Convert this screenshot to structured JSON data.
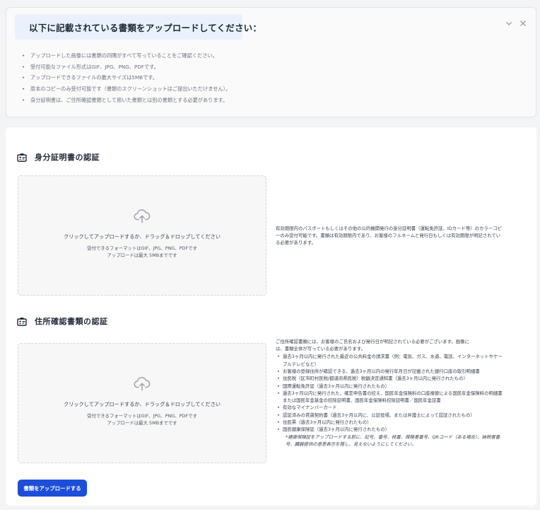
{
  "notice": {
    "title": "以下に記載されている書類をアップロードしてください：",
    "icons": {
      "info": "info-icon",
      "collapse": "chevron-down-icon",
      "close": "close-icon"
    },
    "items": [
      "アップロードした画像には書類の四隅がすべて写っていることをご確認ください。",
      "受付可能なファイル形式はGIF、JPG、PNG、PDFです。",
      "アップロードできるファイルの最大サイズは5MBです。",
      "原本のコピーのみ受付可能です（書類のスクリーンショットはご提出いただけません）。",
      "身分証明書は、ご住所確認書類として用いた書類とは別の書類とする必要があります。"
    ]
  },
  "identity": {
    "title": "身分証明書の認証",
    "icon": "id-card-icon",
    "dropzone": {
      "icon": "cloud-upload-icon",
      "main": "クリックしてアップロードするか、ドラッグ＆ドロップしてください",
      "formats": "受付できるフォーマットはGIF、JPG、PNG、PDFです",
      "max": "アップロードは最大 5MBまでです"
    },
    "lines": [
      "有効期限内のパスポートもしくはその他の公的機関発行の身分証明書（運転免許証、IDカード等）のカラーコピ",
      "ーのみ受付可能です。書類は有効期限内であり、お客様のフルネームと発行日もしくは有効期限が明記されてい",
      "る必要があります。"
    ]
  },
  "address": {
    "title": "住所確認書類の認証",
    "icon": "id-card-icon",
    "dropzone": {
      "icon": "cloud-upload-icon",
      "main": "クリックしてアップロードするか、ドラッグ＆ドロップしてください",
      "formats": "受付できるフォーマットはGIF、JPG、PNG、PDFです",
      "max": "アップロードは最大 5MBまでです"
    },
    "intro": [
      "ご住所確認書類には、お客様のご氏名および発行日が明記されている必要がございます。画像に",
      "は、書類全体が写っている必要があります。"
    ],
    "items": [
      "過去3ヶ月以内に発行された最近の公共料金の請求書（例：電気、ガス、水道、電話、インターネットやケー",
      "ブルテレビなど）",
      "お客様の登録住所が確認できる、過去3ヶ月以内の発行年月日が記載された銀行口座の取引明細書",
      "住民税（区市町村民税/都道府県民税）税額決定通知書（過去3ヶ月以内に発行されたもの）",
      "国際運転免許証（過去3ヶ月以内に発行されたもの）",
      "過去3ヶ月以内に発行された、確定申告書の控え、国民年金保険料の口座振替による国民年金保険料の明細書",
      "または国民年金基金の控除証明書、国民年金保険料控除証明書／国民年金証書",
      "有効なマイナンバーカード",
      "認証済みの賃貸契約書（過去3ヶ月以内に、公証役場、または弁護士によって認証されたもの）",
      "住民票（過去3ヶ月以内に発行されたもの）",
      "国民健康保険証（過去3ヶ月以内に発行されたもの）"
    ],
    "note": [
      "*健康保険証をアップロードする前に、記号、番号、枝番、保険者番号、QRコード（ある場合）、納税者番",
      "号、臓器提供の意思表示を隠し、見えないようにしてください。"
    ]
  },
  "upload_button": "書類をアップロードする",
  "colors": {
    "accent": "#1d4ed8",
    "info_bg": "#e9f1fc"
  }
}
